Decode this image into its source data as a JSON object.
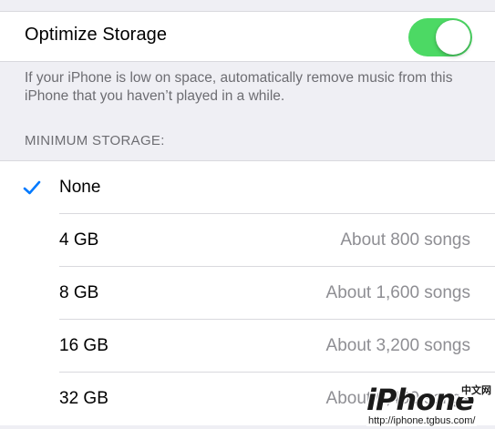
{
  "optimize_storage": {
    "label": "Optimize Storage",
    "enabled": true,
    "description": "If your iPhone is low on space, automatically remove music from this iPhone that you haven’t played in a while."
  },
  "minimum_storage": {
    "header": "MINIMUM STORAGE:",
    "options": [
      {
        "label": "None",
        "detail": "",
        "selected": true
      },
      {
        "label": "4 GB",
        "detail": "About 800 songs",
        "selected": false
      },
      {
        "label": "8 GB",
        "detail": "About 1,600 songs",
        "selected": false
      },
      {
        "label": "16 GB",
        "detail": "About 3,200 songs",
        "selected": false
      },
      {
        "label": "32 GB",
        "detail": "About 6,400 songs",
        "selected": false
      }
    ]
  },
  "colors": {
    "toggle_on": "#4cd964",
    "checkmark": "#007aff",
    "background": "#efeff4"
  },
  "icons": {
    "selected_mark": "checkmark-icon"
  },
  "watermark": {
    "logo": "iPhone",
    "cn": "中文网",
    "url": "http://iphone.tgbus.com/"
  }
}
